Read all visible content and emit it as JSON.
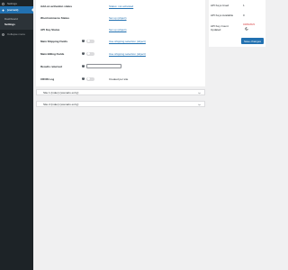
{
  "sidebar": {
    "settings_label": "Settings",
    "current_label": "(current)",
    "submenu": [
      "Dashboard",
      "Settings"
    ],
    "collapse_label": "Collapse menu"
  },
  "form": {
    "activation": {
      "label": "Add-on activation status",
      "value": "Status: not activated"
    },
    "woocommerce": {
      "label": "WooCommerce Status",
      "value": "Set up (object)"
    },
    "api_key": {
      "label": "API Key Status",
      "value": "Set up (object)"
    },
    "shipping": {
      "label": "Main Shipping Fields",
      "help": "?",
      "enabled": false,
      "value": "Use shipping selection (object)"
    },
    "billing": {
      "label": "Main Billing Fields",
      "help": "?",
      "enabled": false,
      "value": "Use shipping selection (object)"
    },
    "results": {
      "label": "Results returned",
      "help": "?",
      "input_value": ""
    },
    "cron": {
      "label": "CRON Log",
      "help": "?",
      "enabled": false,
      "value": "Created per site"
    }
  },
  "panels": [
    {
      "title": "Site 1 (index) (scenario entry)"
    },
    {
      "title": "Site 2 (index) (scenario entry)"
    }
  ],
  "status_box": {
    "used_label": "API Keys Used",
    "used_value": "1",
    "available_label": "API Keys Available",
    "available_value": "0",
    "count_label_1": "API Key Count",
    "count_label_2": "Updated",
    "count_value": "04/06/2023",
    "save_label": "Save changes"
  },
  "colors": {
    "sidebar_bg": "#1d2327",
    "accent": "#2271b1",
    "date_red": "#d63638"
  }
}
